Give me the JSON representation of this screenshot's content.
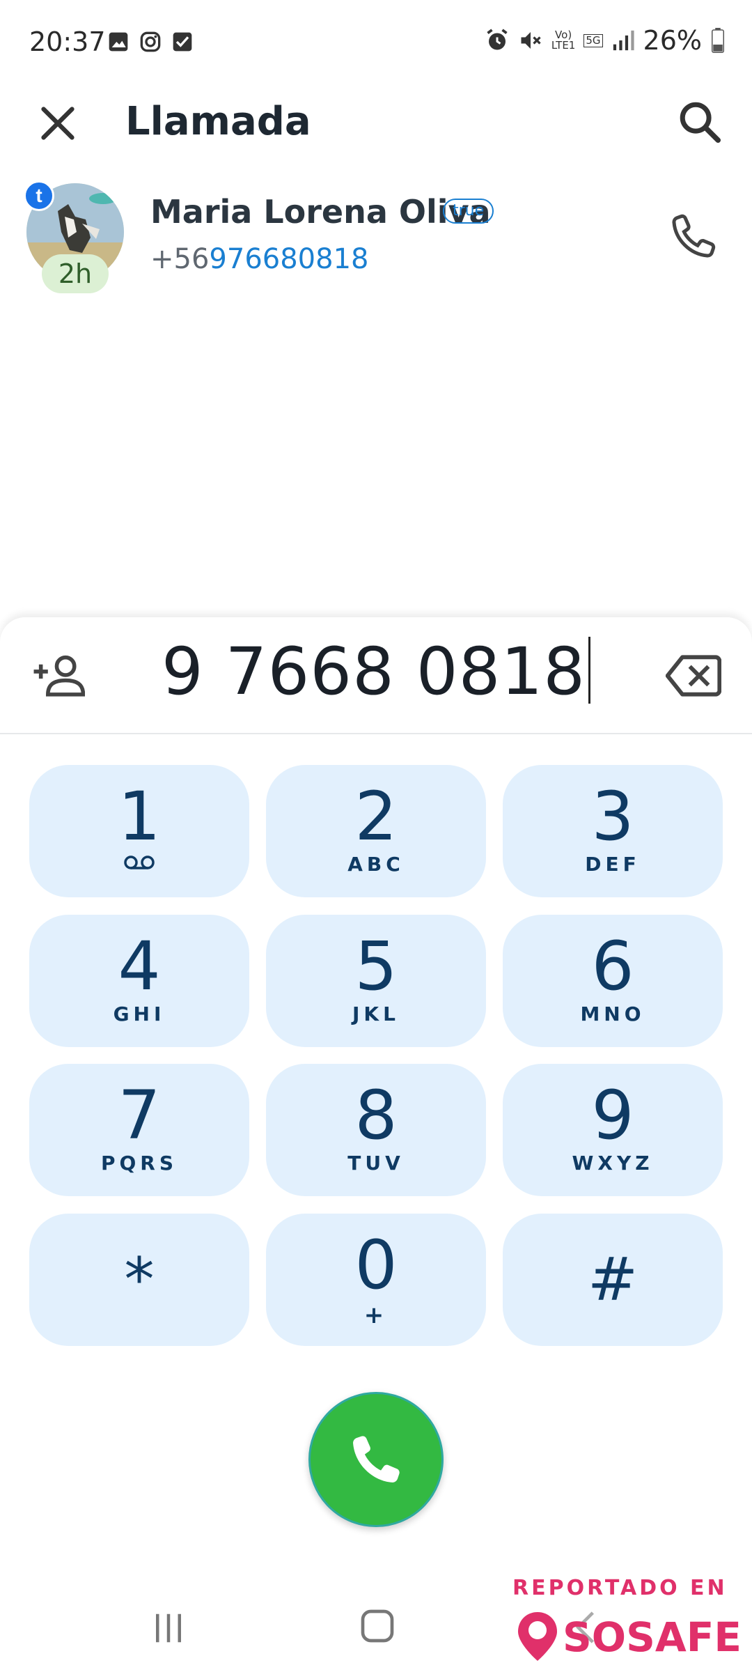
{
  "status_bar": {
    "time": "20:37",
    "network_top": "Vo)",
    "network_bottom": "LTE1",
    "network_type": "5G",
    "battery_percent": "26%",
    "icons": [
      "image-icon",
      "instagram-icon",
      "checkbox-icon",
      "alarm-icon",
      "mute-icon",
      "signal-icon",
      "battery-icon"
    ]
  },
  "header": {
    "title": "Llamada"
  },
  "contact": {
    "name": "Maria Lorena Oliva",
    "tag": "true",
    "phone_prefix": "+56",
    "phone_rest": "976680818",
    "time_ago": "2h",
    "badge_letter": "t"
  },
  "dialer": {
    "number": "9 7668 0818",
    "keys": [
      {
        "digit": "1",
        "sub": ""
      },
      {
        "digit": "2",
        "sub": "ABC"
      },
      {
        "digit": "3",
        "sub": "DEF"
      },
      {
        "digit": "4",
        "sub": "GHI"
      },
      {
        "digit": "5",
        "sub": "JKL"
      },
      {
        "digit": "6",
        "sub": "MNO"
      },
      {
        "digit": "7",
        "sub": "PQRS"
      },
      {
        "digit": "8",
        "sub": "TUV"
      },
      {
        "digit": "9",
        "sub": "WXYZ"
      },
      {
        "digit": "*",
        "sub": ""
      },
      {
        "digit": "0",
        "sub": "+"
      },
      {
        "digit": "#",
        "sub": ""
      }
    ]
  },
  "watermark": {
    "line1": "REPORTADO EN",
    "brand": "SOSAFE"
  },
  "colors": {
    "accent_blue": "#1a7fd1",
    "key_bg": "#e2f0fd",
    "key_text": "#0f3a63",
    "call_green": "#33b942",
    "watermark_pink": "#e0306a"
  }
}
